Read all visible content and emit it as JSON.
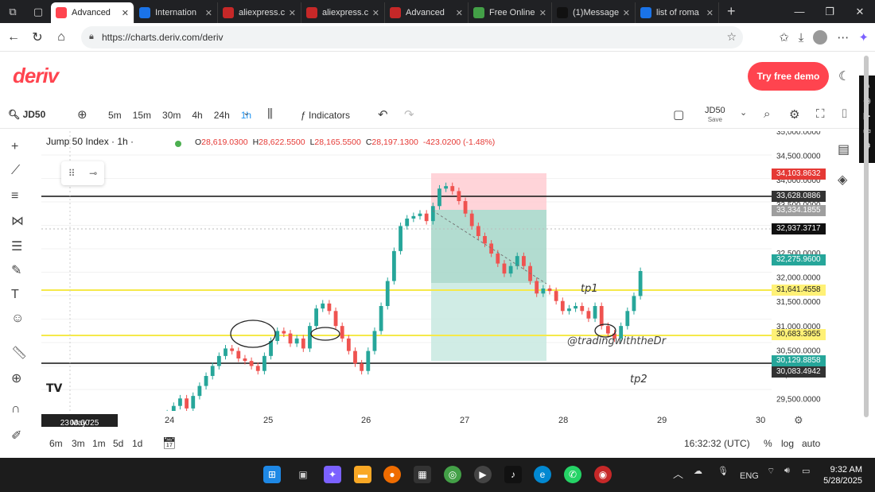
{
  "browser": {
    "tabs": [
      {
        "label": "Advanced",
        "color": "#ff444f",
        "active": true
      },
      {
        "label": "Internation",
        "color": "#1a73e8"
      },
      {
        "label": "aliexpress.c",
        "color": "#c62828"
      },
      {
        "label": "aliexpress.c",
        "color": "#c62828"
      },
      {
        "label": "Advanced",
        "color": "#c62828"
      },
      {
        "label": "Free Online",
        "color": "#43a047"
      },
      {
        "label": "(1)Message",
        "color": "#111111"
      },
      {
        "label": "list of roma",
        "color": "#1a73e8"
      }
    ],
    "url": "https://charts.deriv.com/deriv"
  },
  "app": {
    "logo": "deriv",
    "demo_button": "Try free demo"
  },
  "toolbar": {
    "symbol": "JD50",
    "timeframes": [
      "5m",
      "15m",
      "30m",
      "4h",
      "24h",
      "1h"
    ],
    "active_timeframe": "1h",
    "indicators_label": "Indicators",
    "symbol_right": "JD50",
    "save_label": "Save"
  },
  "chart_header": {
    "title": "Jump 50 Index · 1h ·",
    "ohlc": [
      {
        "k": "O",
        "v": "28,619.0300"
      },
      {
        "k": "H",
        "v": "28,622.5500"
      },
      {
        "k": "L",
        "v": "28,165.5500"
      },
      {
        "k": "C",
        "v": "28,197.1300"
      },
      {
        "k": "",
        "v": "-423.0200 (-1.48%)"
      }
    ]
  },
  "price_tags": [
    {
      "value": "34,103.8632",
      "price": 34103.8632,
      "color": "#e53935"
    },
    {
      "value": "33,628.0886",
      "price": 33628.0886,
      "color": "#333333"
    },
    {
      "value": "33,334.1855",
      "price": 33334.1855,
      "color": "#9e9e9e"
    },
    {
      "value": "32,937.3717",
      "price": 32937.3717,
      "color": "#111111"
    },
    {
      "value": "32,275.9600",
      "price": 32275.96,
      "color": "#26a69a"
    },
    {
      "value": "31,641.4558",
      "price": 31641.4558,
      "color": "#fff176"
    },
    {
      "value": "30,683.3955",
      "price": 30683.3955,
      "color": "#fff176"
    },
    {
      "value": "30,129.8858",
      "price": 30129.8858,
      "color": "#26a69a"
    },
    {
      "value": "30,083.4942",
      "price": 30083.4942,
      "color": "#333333"
    }
  ],
  "annotations": {
    "tp1": "tp1",
    "tp2": "tp2",
    "watermark": "@tradingwiththeDr"
  },
  "chart_data": {
    "type": "candlestick",
    "x_ticks": [
      "24",
      "25",
      "26",
      "27",
      "28",
      "29",
      "30"
    ],
    "y_ticks": [
      "35,000.0000",
      "34,500.0000",
      "34,000.0000",
      "33,500.0000",
      "33,000.0000",
      "32,500.0000",
      "32,000.0000",
      "31,500.0000",
      "31,000.0000",
      "30,500.0000",
      "30,000.0000",
      "29,500.0000"
    ],
    "ylim": [
      29400,
      35000
    ],
    "closes": [
      29200,
      29350,
      29500,
      29650,
      29450,
      29700,
      29900,
      30100,
      30300,
      30500,
      30650,
      30600,
      30450,
      30400,
      30300,
      30200,
      30500,
      30800,
      31000,
      30950,
      30750,
      30850,
      30650,
      31100,
      31450,
      31550,
      31400,
      31100,
      30850,
      30600,
      30350,
      30200,
      30600,
      31000,
      31500,
      32000,
      32600,
      33100,
      33250,
      33300,
      33350,
      33200,
      33500,
      33850,
      33900,
      33800,
      33600,
      33350,
      33100,
      32900,
      32750,
      32550,
      32350,
      32150,
      32300,
      32500,
      32300,
      32000,
      31750,
      31850,
      31800,
      31600,
      31400,
      31450,
      31500,
      31400,
      31250,
      31500,
      31100,
      30950,
      30850,
      31100,
      31400,
      31700,
      32200
    ]
  },
  "xaxis": {
    "date_label": "23 May '25",
    "time_label": "00:00"
  },
  "bottombar": {
    "periods": [
      "6m",
      "3m",
      "1m",
      "5d",
      "1d"
    ],
    "clock": "16:32:32 (UTC)",
    "percent": "%",
    "log": "log",
    "auto": "auto"
  },
  "taskbar": {
    "lang": "ENG",
    "time": "9:32 AM",
    "date": "5/28/2025"
  }
}
